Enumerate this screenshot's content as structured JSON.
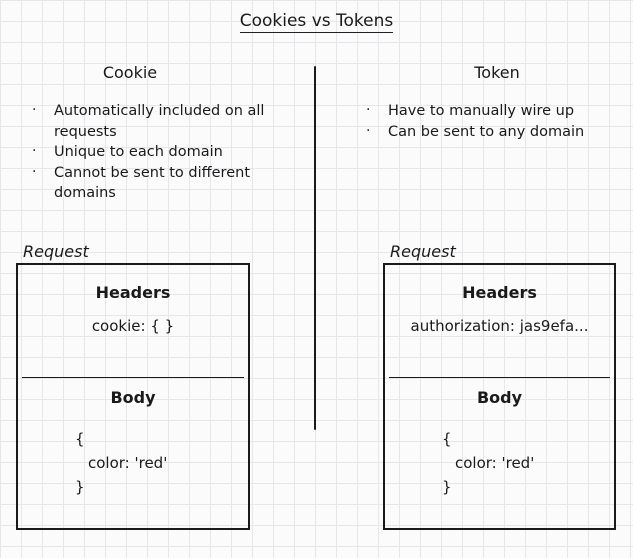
{
  "title": "Cookies vs Tokens",
  "cookie": {
    "heading": "Cookie",
    "points": [
      "Automatically included on all requests",
      "Unique to each domain",
      "Cannot be sent to different domains"
    ],
    "request": {
      "label": "Request",
      "headers_title": "Headers",
      "headers_value": "cookie: { }",
      "body_title": "Body",
      "body_open": "{",
      "body_content": "color: 'red'",
      "body_close": "}"
    }
  },
  "token": {
    "heading": "Token",
    "points": [
      "Have to manually wire up",
      "Can be sent to any domain"
    ],
    "request": {
      "label": "Request",
      "headers_title": "Headers",
      "headers_value": "authorization: jas9efa...",
      "body_title": "Body",
      "body_open": "{",
      "body_content": "color: 'red'",
      "body_close": "}"
    }
  }
}
